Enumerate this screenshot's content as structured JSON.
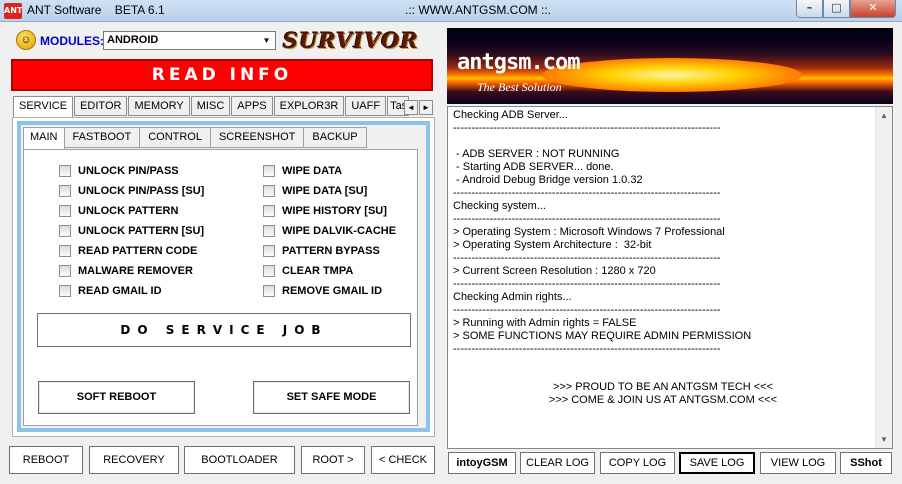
{
  "window": {
    "icon_text": "ANT",
    "title": "ANT Software    BETA 6.1",
    "center_title": ".:: WWW.ANTGSM.COM ::.",
    "minimize": "–",
    "maximize": "□",
    "close": "✕"
  },
  "modules": {
    "label": "MODULES:",
    "selected": "ANDROID",
    "logo_text": "SURVIVOR"
  },
  "read_info_label": "READ INFO",
  "tabs": [
    "SERVICE",
    "EDITOR",
    "MEMORY",
    "MISC",
    "APPS",
    "EXPLOR3R",
    "UAFF",
    "Tas"
  ],
  "active_tab": "SERVICE",
  "subtabs": [
    "MAIN",
    "FASTBOOT",
    "CONTROL",
    "SCREENSHOT",
    "BACKUP"
  ],
  "active_subtab": "MAIN",
  "checkboxes_left": [
    "UNLOCK PIN/PASS",
    "UNLOCK PIN/PASS [SU]",
    "UNLOCK PATTERN",
    "UNLOCK PATTERN [SU]",
    "READ PATTERN CODE",
    "MALWARE REMOVER",
    "READ GMAIL ID"
  ],
  "checkboxes_right": [
    "WIPE DATA",
    "WIPE DATA [SU]",
    "WIPE HISTORY [SU]",
    "WIPE DALVIK-CACHE",
    "PATTERN BYPASS",
    "CLEAR TMPA",
    "REMOVE GMAIL ID"
  ],
  "service_job_label": "DO SERVICE JOB",
  "soft_reboot_label": "SOFT REBOOT",
  "safe_mode_label": "SET SAFE MODE",
  "bottom_buttons": {
    "reboot": "REBOOT",
    "recovery": "RECOVERY",
    "bootloader": "BOOTLOADER",
    "root": "ROOT >",
    "check": "< CHECK"
  },
  "banner": {
    "brand": "antgsm.com",
    "tagline": "The Best Solution"
  },
  "log_lines": [
    "Checking ADB Server...",
    "-------------------------------------------------------------------------",
    "",
    " - ADB SERVER : NOT RUNNING",
    " - Starting ADB SERVER... done.",
    " - Android Debug Bridge version 1.0.32",
    "-------------------------------------------------------------------------",
    "Checking system...",
    "-------------------------------------------------------------------------",
    "> Operating System : Microsoft Windows 7 Professional",
    "> Operating System Architecture :  32-bit",
    "-------------------------------------------------------------------------",
    "> Current Screen Resolution : 1280 x 720",
    "-------------------------------------------------------------------------",
    "Checking Admin rights...",
    "-------------------------------------------------------------------------",
    "> Running with Admin rights = FALSE",
    "> SOME FUNCTIONS MAY REQUIRE ADMIN PERMISSION",
    "-------------------------------------------------------------------------"
  ],
  "log_footer": [
    ">>> PROUD TO BE AN ANTGSM TECH <<<",
    ">>> COME & JOIN US AT ANTGSM.COM <<<"
  ],
  "log_buttons": {
    "user": "intoyGSM",
    "clear": "CLEAR LOG",
    "copy": "COPY LOG",
    "save": "SAVE LOG",
    "view": "VIEW LOG",
    "shot": "SShot"
  },
  "icons": {
    "modules": "smiley-icon",
    "scroll_left": "◄",
    "scroll_right": "►",
    "dropdown": "▼",
    "scroll_up": "▲",
    "scroll_down": "▼"
  }
}
